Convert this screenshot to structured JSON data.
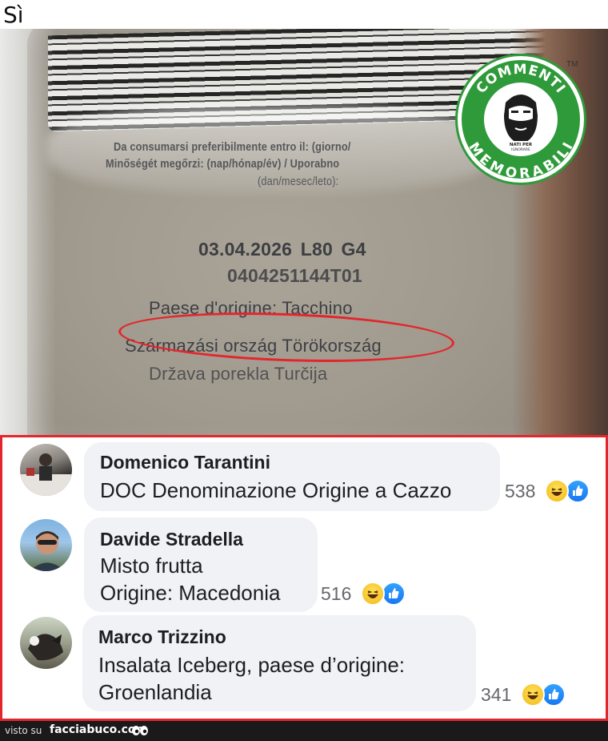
{
  "caption": "Sì",
  "photo": {
    "line1": "Da consumarsi preferibilmente entro il: (giorno/",
    "line2": "Minőségét megőrzi: (nap/hónap/év) / Uporabno",
    "line3": "(dan/mesec/leto):",
    "date_line": "03.04.2026  L80  G4",
    "lot_line": "0404251144T01",
    "origin_it": "Paese d'origine: Tacchino",
    "origin_hu": "Származási ország  Törökország",
    "origin_sl": "Država porekla  Turčija"
  },
  "logo": {
    "top_text": "COMMENTI",
    "bottom_text": "MEMORABILI",
    "badge_text_1": "NATI PER",
    "badge_text_2": "IGNORARE",
    "trademark": "TM",
    "colors": {
      "ring": "#2f9a3a",
      "text": "#ffffff"
    }
  },
  "comments": [
    {
      "author": "Domenico Tarantini",
      "lines": [
        "DOC Denominazione Origine a Cazzo"
      ],
      "reaction_count": "538",
      "reactions": [
        "haha-icon",
        "like-icon"
      ]
    },
    {
      "author": "Davide Stradella",
      "lines": [
        "Misto frutta",
        "Origine: Macedonia"
      ],
      "reaction_count": "516",
      "reactions": [
        "haha-icon",
        "like-icon"
      ]
    },
    {
      "author": "Marco Trizzino",
      "lines": [
        "Insalata Iceberg, paese d’origine:",
        "Groenlandia"
      ],
      "reaction_count": "341",
      "reactions": [
        "haha-icon",
        "like-icon"
      ]
    }
  ],
  "footer": {
    "prefix": "visto su",
    "site": "facciabuco.com"
  },
  "colors": {
    "highlight_red": "#e3262d",
    "bubble_bg": "#f0f2f5",
    "like_blue": "#1877f2",
    "haha_yellow": "#f7c52a"
  }
}
